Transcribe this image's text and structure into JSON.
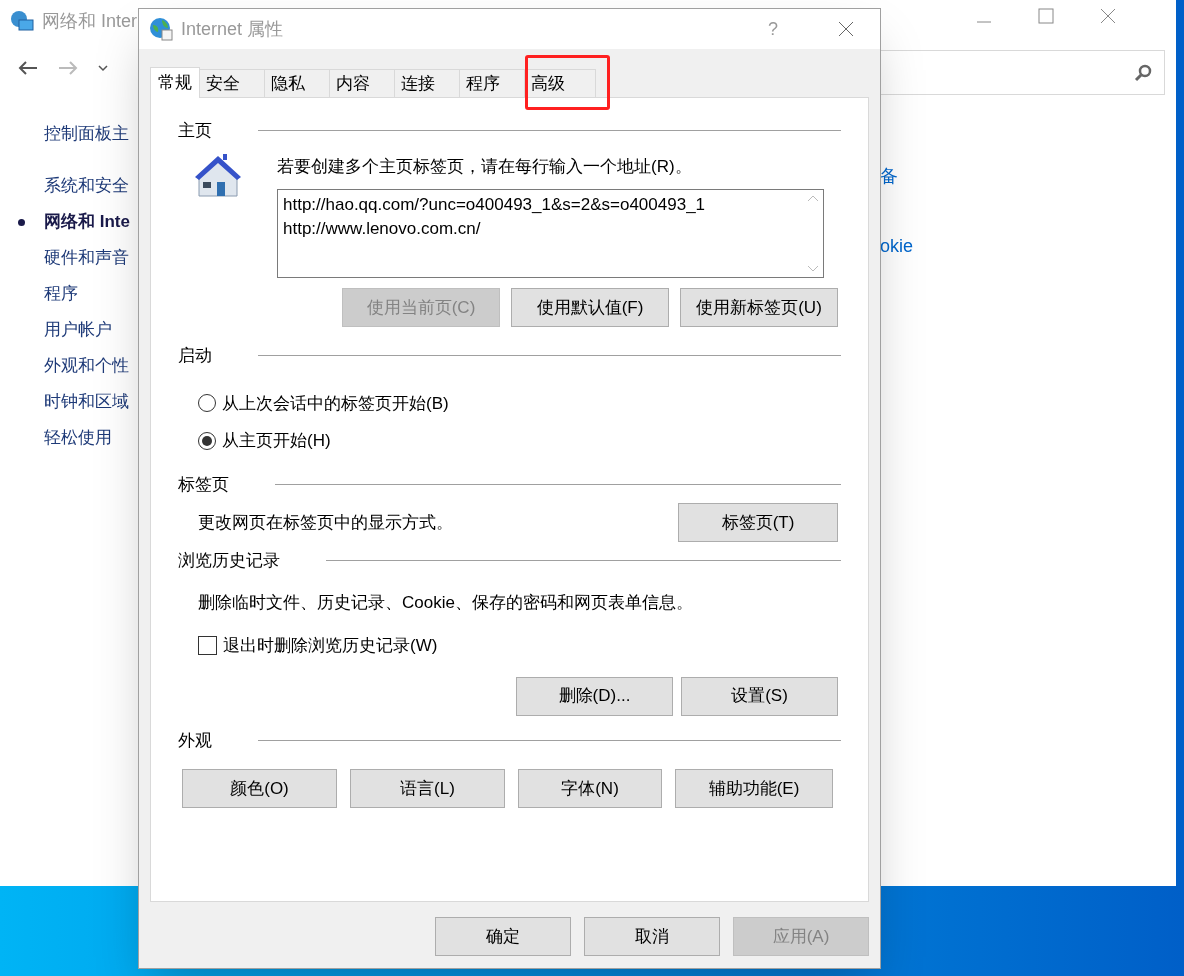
{
  "background_window": {
    "title": "网络和 Inter",
    "sidebar": {
      "home_link": "控制面板主",
      "items": [
        {
          "label": "系统和安全",
          "selected": false
        },
        {
          "label": "网络和 Inte",
          "selected": true
        },
        {
          "label": "硬件和声音",
          "selected": false
        },
        {
          "label": "程序",
          "selected": false
        },
        {
          "label": "用户帐户",
          "selected": false
        },
        {
          "label": "外观和个性",
          "selected": false
        },
        {
          "label": "时钟和区域",
          "selected": false
        },
        {
          "label": "轻松使用",
          "selected": false
        }
      ]
    },
    "links": [
      "备",
      "okie"
    ]
  },
  "dialog": {
    "title": "Internet 属性",
    "help": "?",
    "tabs": [
      {
        "label": "常规",
        "selected": true,
        "highlighted": false
      },
      {
        "label": "安全",
        "selected": false,
        "highlighted": false
      },
      {
        "label": "隐私",
        "selected": false,
        "highlighted": false
      },
      {
        "label": "内容",
        "selected": false,
        "highlighted": false
      },
      {
        "label": "连接",
        "selected": false,
        "highlighted": false
      },
      {
        "label": "程序",
        "selected": false,
        "highlighted": false
      },
      {
        "label": "高级",
        "selected": false,
        "highlighted": true
      }
    ],
    "homepage": {
      "heading": "主页",
      "hint": "若要创建多个主页标签页，请在每行输入一个地址(R)。",
      "urls": "http://hao.qq.com/?unc=o400493_1&s=2&s=o400493_1\nhttp://www.lenovo.com.cn/",
      "buttons": [
        {
          "label": "使用当前页(C)",
          "disabled": true
        },
        {
          "label": "使用默认值(F)",
          "disabled": false
        },
        {
          "label": "使用新标签页(U)",
          "disabled": false
        }
      ]
    },
    "startup": {
      "heading": "启动",
      "options": [
        {
          "label": "从上次会话中的标签页开始(B)",
          "selected": false
        },
        {
          "label": "从主页开始(H)",
          "selected": true
        }
      ]
    },
    "tabs_section": {
      "heading": "标签页",
      "text": "更改网页在标签页中的显示方式。",
      "button": {
        "label": "标签页(T)",
        "disabled": false
      }
    },
    "history": {
      "heading": "浏览历史记录",
      "text": "删除临时文件、历史记录、Cookie、保存的密码和网页表单信息。",
      "checkbox": {
        "label": "退出时删除浏览历史记录(W)",
        "checked": false
      },
      "buttons": [
        {
          "label": "删除(D)...",
          "disabled": false
        },
        {
          "label": "设置(S)",
          "disabled": false
        }
      ]
    },
    "appearance": {
      "heading": "外观",
      "buttons": [
        {
          "label": "颜色(O)",
          "disabled": false
        },
        {
          "label": "语言(L)",
          "disabled": false
        },
        {
          "label": "字体(N)",
          "disabled": false
        },
        {
          "label": "辅助功能(E)",
          "disabled": false
        }
      ]
    },
    "footer_buttons": [
      {
        "label": "确定",
        "disabled": false
      },
      {
        "label": "取消",
        "disabled": false
      },
      {
        "label": "应用(A)",
        "disabled": true
      }
    ]
  }
}
